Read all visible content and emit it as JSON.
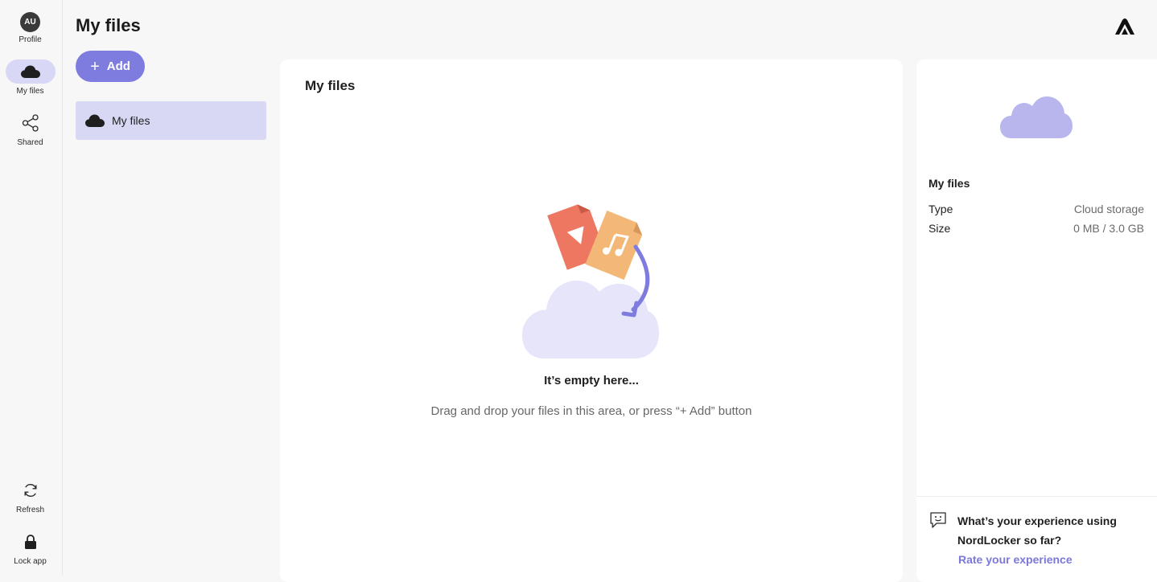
{
  "rail": {
    "profile": {
      "initials": "AU",
      "label": "Profile"
    },
    "my_files": {
      "label": "My files"
    },
    "shared": {
      "label": "Shared"
    },
    "refresh": {
      "label": "Refresh"
    },
    "lock": {
      "label": "Lock app"
    }
  },
  "header": {
    "title": "My files"
  },
  "toolbar": {
    "add_label": "Add"
  },
  "tree": {
    "items": [
      {
        "label": "My files",
        "icon": "cloud-icon"
      }
    ]
  },
  "main": {
    "title": "My files",
    "empty_title": "It’s empty here...",
    "empty_hint": "Drag and drop your files in this area, or press “+ Add” button"
  },
  "details": {
    "name": "My files",
    "type_label": "Type",
    "type_value": "Cloud storage",
    "size_label": "Size",
    "size_value": "0 MB / 3.0 GB"
  },
  "feedback": {
    "question": "What’s your experience using NordLocker so far?",
    "link": "Rate your experience"
  },
  "colors": {
    "accent": "#7f7cdf",
    "accent_light": "#d9d8f4",
    "cloud_illustration": "#b9b6ee",
    "file_red": "#ee7761",
    "file_orange": "#f3b877"
  }
}
